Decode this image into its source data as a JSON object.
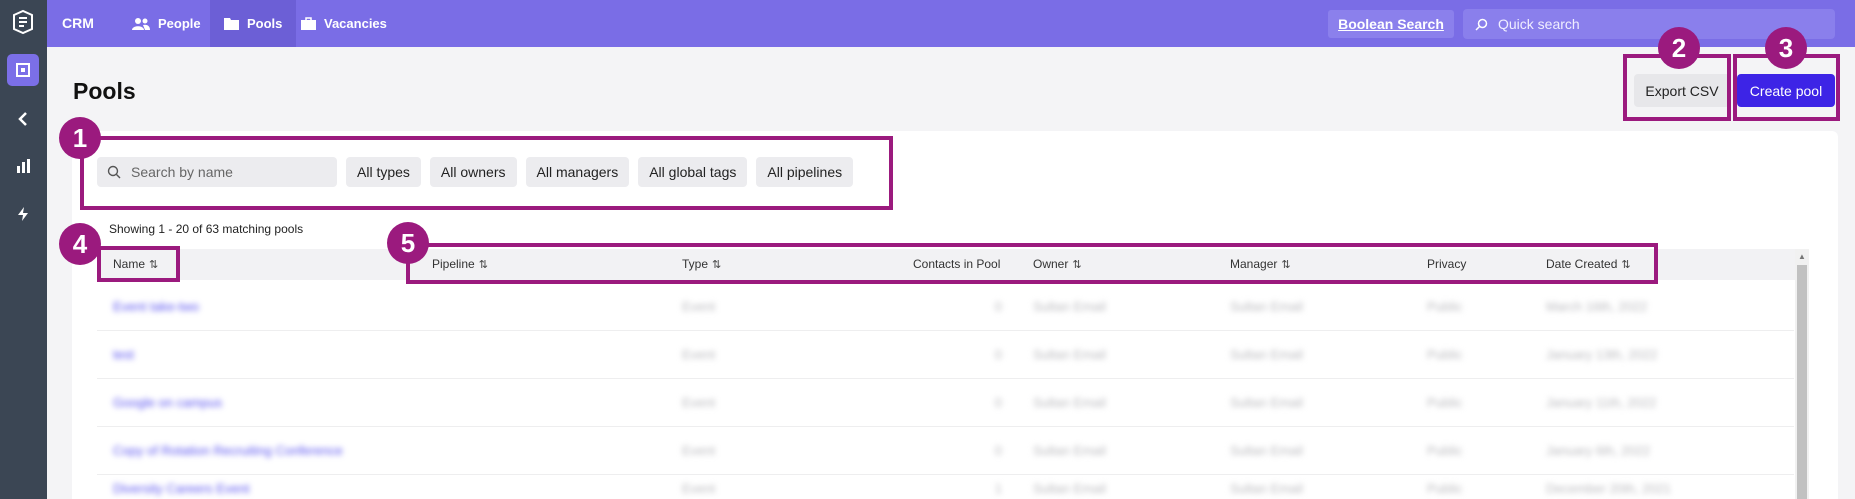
{
  "topbar": {
    "brand": "CRM",
    "nav": [
      {
        "label": "People",
        "icon": "people-icon"
      },
      {
        "label": "Pools",
        "icon": "folder-icon"
      },
      {
        "label": "Vacancies",
        "icon": "briefcase-icon"
      }
    ],
    "boolean_search": "Boolean Search",
    "quick_search_placeholder": "Quick search"
  },
  "page": {
    "title": "Pools",
    "export_label": "Export CSV",
    "create_label": "Create pool"
  },
  "filters": {
    "search_placeholder": "Search by name",
    "buttons": [
      "All types",
      "All owners",
      "All managers",
      "All global tags",
      "All pipelines"
    ]
  },
  "showing": "Showing 1 - 20 of 63 matching pools",
  "table": {
    "columns": [
      "Name",
      "Pipeline",
      "Type",
      "Contacts in Pool",
      "Owner",
      "Manager",
      "Privacy",
      "Date Created"
    ],
    "rows": [
      {
        "name": "Event take-two",
        "type": "Event",
        "contacts": "0",
        "owner": "Sultan Email",
        "manager": "Sultan Email",
        "privacy": "Public",
        "date": "March 16th, 2022"
      },
      {
        "name": "test",
        "type": "Event",
        "contacts": "0",
        "owner": "Sultan Email",
        "manager": "Sultan Email",
        "privacy": "Public",
        "date": "January 13th, 2022"
      },
      {
        "name": "Google on campus",
        "type": "Event",
        "contacts": "0",
        "owner": "Sultan Email",
        "manager": "Sultan Email",
        "privacy": "Public",
        "date": "January 11th, 2022"
      },
      {
        "name": "Copy of Rotation Recruiting Conference",
        "type": "Event",
        "contacts": "0",
        "owner": "Sultan Email",
        "manager": "Sultan Email",
        "privacy": "Public",
        "date": "January 6th, 2022"
      },
      {
        "name": "Diversity Careers Event",
        "type": "Event",
        "contacts": "1",
        "owner": "Sultan Email",
        "manager": "Sultan Email",
        "privacy": "Public",
        "date": "December 20th, 2021"
      }
    ]
  },
  "annotations": [
    "1",
    "2",
    "3",
    "4",
    "5"
  ],
  "colors": {
    "accent": "#7a6de6",
    "primary_button": "#3d24e6",
    "annotation": "#9b1a7e"
  }
}
